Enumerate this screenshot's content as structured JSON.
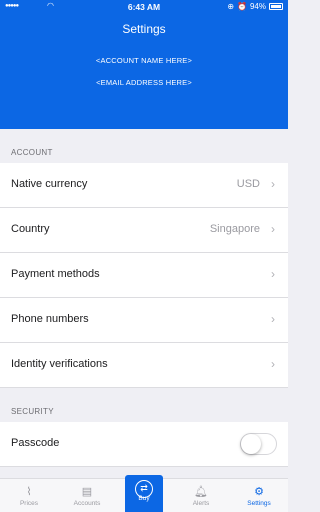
{
  "status": {
    "signal": "●●●●●",
    "time": "6:43 AM",
    "battery": "94%"
  },
  "header": {
    "title": "Settings",
    "account_name": "<ACCOUNT NAME HERE>",
    "email": "<EMAIL ADDRESS HERE>"
  },
  "sections": {
    "account": "ACCOUNT",
    "security": "SECURITY"
  },
  "rows": [
    {
      "label": "Native currency",
      "value": "USD"
    },
    {
      "label": "Country",
      "value": "Singapore"
    },
    {
      "label": "Payment methods",
      "value": ""
    },
    {
      "label": "Phone numbers",
      "value": ""
    },
    {
      "label": "Identity verifications",
      "value": ""
    }
  ],
  "passcode": {
    "label": "Passcode",
    "enabled": false
  },
  "tabs": [
    {
      "label": "Prices",
      "icon": "chart-icon"
    },
    {
      "label": "Accounts",
      "icon": "document-icon"
    },
    {
      "label": "Buy",
      "icon": "exchange-icon"
    },
    {
      "label": "Alerts",
      "icon": "bell-icon"
    },
    {
      "label": "Settings",
      "icon": "gear-icon"
    }
  ],
  "colors": {
    "brand": "#0c67e4",
    "background": "#efeff4",
    "inactive": "#9a9aa0"
  }
}
